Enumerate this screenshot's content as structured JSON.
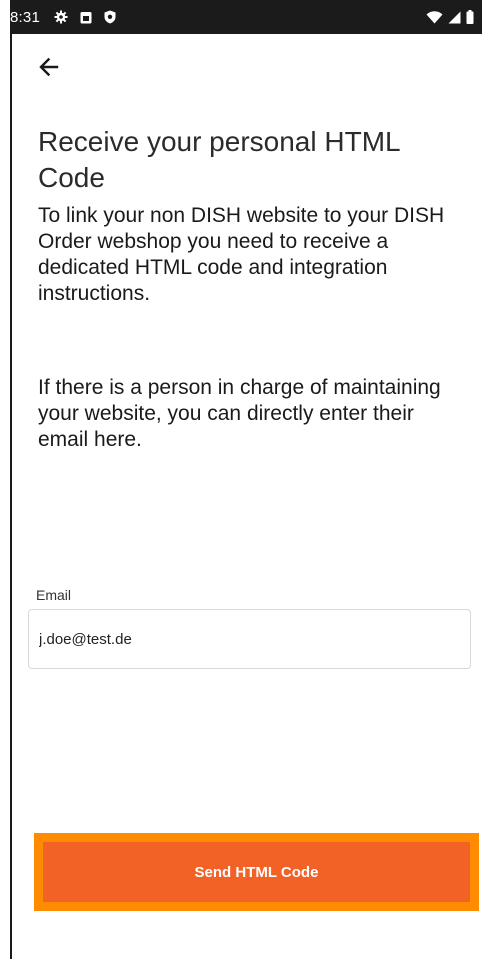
{
  "status_bar": {
    "time": "8:31",
    "left_icons": [
      "gear-icon",
      "calendar-icon",
      "shield-icon"
    ],
    "right_icons": [
      "wifi-icon",
      "signal-icon",
      "battery-icon"
    ]
  },
  "header": {
    "back_icon": "arrow-left-icon"
  },
  "main": {
    "title": "Receive your personal HTML Code",
    "intro": "To link your non DISH website to your DISH Order webshop you need to receive a dedicated HTML code and integration instructions.",
    "hint": "If there is a person in charge of maintaining your website, you can directly enter their email here."
  },
  "form": {
    "email_label": "Email",
    "email_value": "j.doe@test.de"
  },
  "actions": {
    "send_label": "Send HTML Code"
  },
  "colors": {
    "status_bar": "#1b1b1b",
    "accent_button": "#f26126",
    "focus_outline": "#ff8c00"
  }
}
